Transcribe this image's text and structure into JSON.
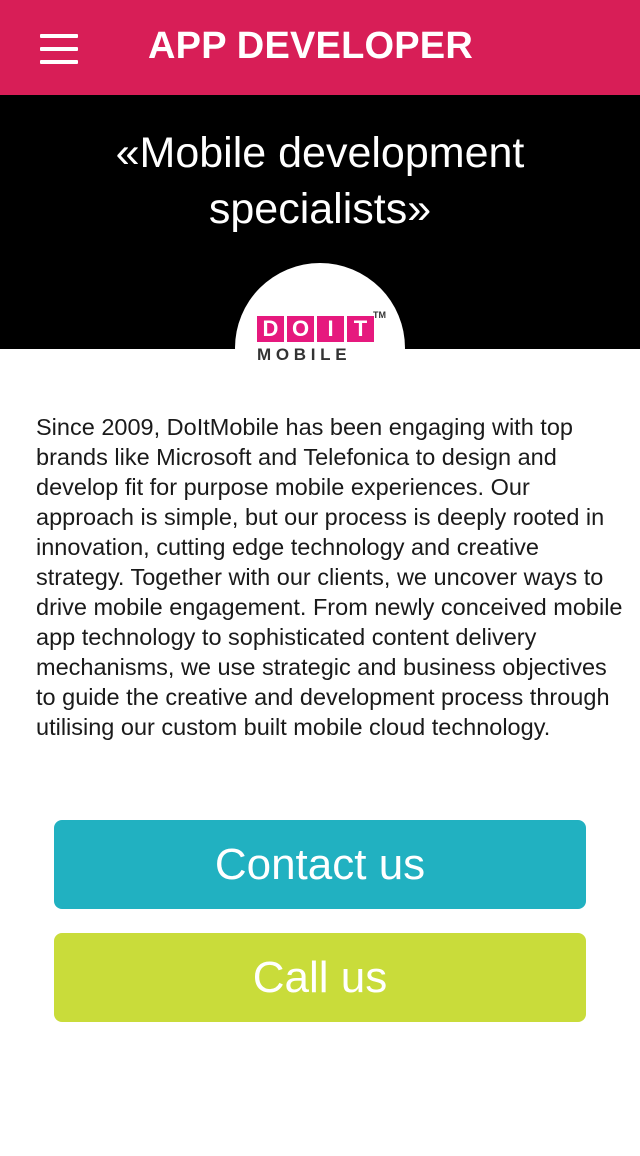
{
  "header": {
    "title": "APP DEVELOPER",
    "menu_icon": "hamburger-menu-icon",
    "background_color": "#d81e57"
  },
  "hero": {
    "tagline_line1": "«Mobile development",
    "tagline_line2": "specialists»",
    "background_color": "#000000"
  },
  "logo": {
    "letters": [
      "D",
      "O",
      "I",
      "T"
    ],
    "subtitle": "MOBILE",
    "trademark": "TM",
    "accent_color": "#e6197e"
  },
  "about": {
    "text": "Since 2009, DoItMobile has been engaging with top brands like Microsoft and Telefonica to design and develop fit for purpose mobile experiences. Our approach is simple, but our process is deeply rooted in innovation, cutting edge technology and creative strategy. Together with our clients, we uncover ways to drive mobile engagement. From newly conceived mobile app technology to sophisticated content delivery mechanisms, we use strategic and business objectives to guide the creative and development process through utilising our custom built mobile cloud technology."
  },
  "actions": {
    "contact_label": "Contact us",
    "contact_color": "#21b1c1",
    "call_label": "Call us",
    "call_color": "#c9dc3a"
  }
}
